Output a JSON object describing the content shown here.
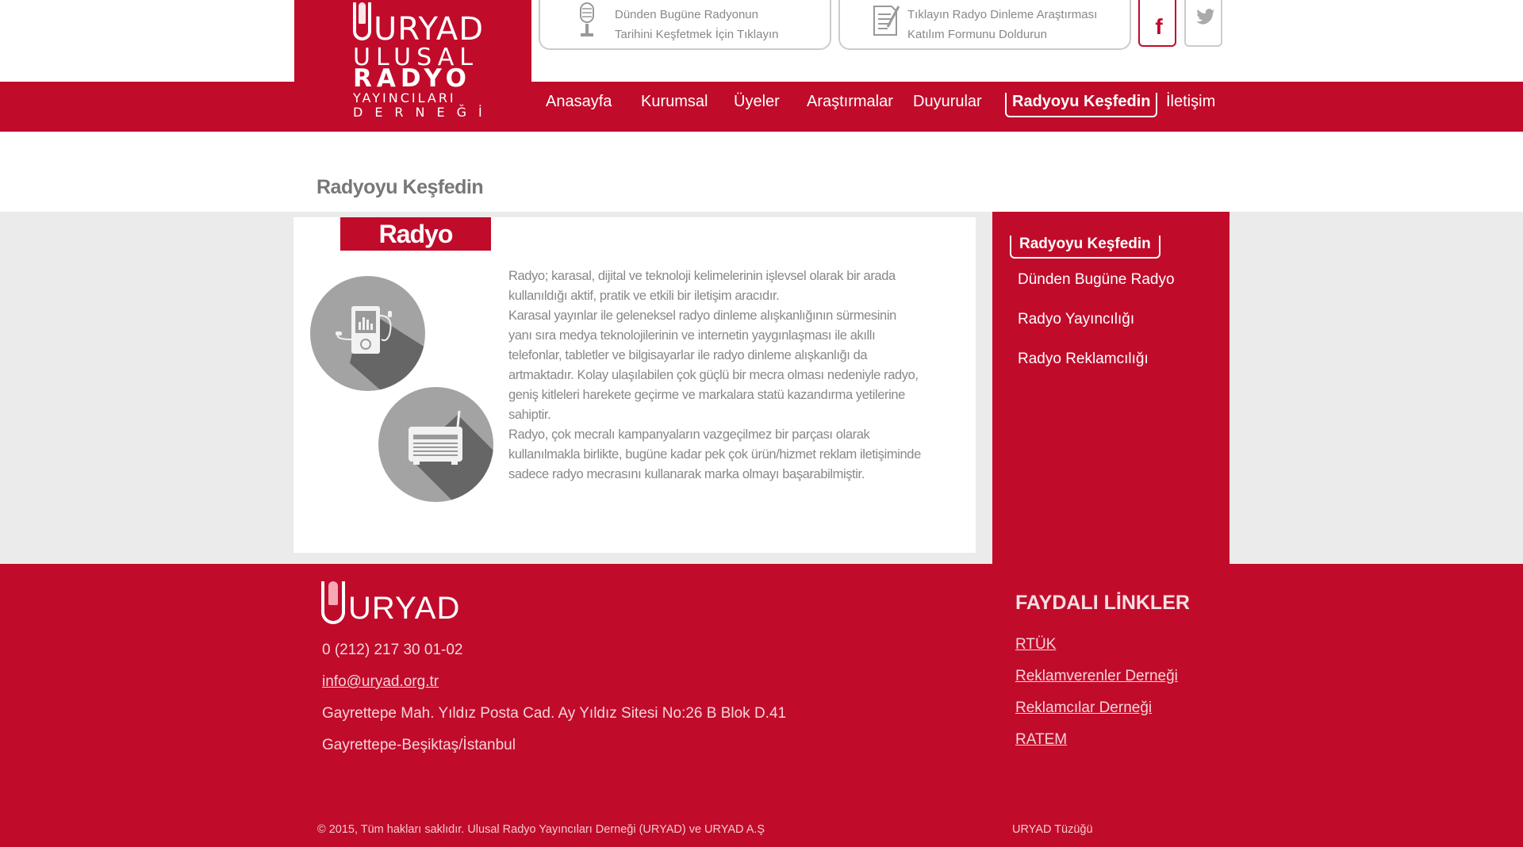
{
  "logo": {
    "brand": "URYAD",
    "line1": "ULUSAL",
    "line2": "RADYO",
    "line3": "YAYINCILARI",
    "line4": "DERNEĞİ"
  },
  "top_cards": [
    {
      "icon": "microphone-icon",
      "line1": "Dünden Bugüne Radyonun",
      "line2": "Tarihini Keşfetmek İçin Tıklayın"
    },
    {
      "icon": "document-icon",
      "line1": "Tıklayın Radyo Dinleme Araştırması",
      "line2": "Katılım Formunu Doldurun"
    }
  ],
  "social": [
    {
      "icon": "facebook-icon",
      "label": "f"
    },
    {
      "icon": "twitter-icon"
    }
  ],
  "nav": {
    "items": [
      "Anasayfa",
      "Kurumsal",
      "Üyeler",
      "Araştırmalar",
      "Duyurular",
      "Radyoyu Keşfedin",
      "İletişim"
    ],
    "active": "Radyoyu Keşfedin"
  },
  "page_title": "Radyoyu Keşfedin",
  "article": {
    "tag": "Radyo",
    "icons": [
      "mp3-player-icon",
      "radio-icon"
    ],
    "paragraphs": [
      "Radyo; karasal, dijital ve teknoloji kelimelerinin işlevsel olarak bir arada kullanıldığı aktif, pratik ve etkili bir iletişim aracıdır.",
      "Karasal yayınlar ile geleneksel radyo dinleme alışkanlığının sürmesinin yanı sıra medya teknolojilerinin ve internetin yaygınlaşması ile akıllı telefonlar, tabletler ve bilgisayarlar ile radyo dinleme alışkanlığı da artmaktadır. Kolay ulaşılabilen çok güçlü bir mecra olması nedeniyle radyo, geniş kitleleri harekete geçirme ve markalara statü kazandırma yetilerine sahiptir.",
      "Radyo, çok mecralı kampanyaların vazgeçilmez bir parçası olarak kullanılmakla birlikte, bugüne kadar pek çok ürün/hizmet reklam iletişiminde sadece radyo mecrasını kullanarak marka olmayı başarabilmiştir."
    ]
  },
  "sidebar": {
    "heading": "Radyoyu Keşfedin",
    "items": [
      "Dünden Bugüne Radyo",
      "Radyo Yayıncılığı",
      "Radyo Reklamcılığı"
    ]
  },
  "footer": {
    "brand": "URYAD",
    "phone": "0 (212) 217 30 01-02",
    "email": "info@uryad.org.tr",
    "address1": "Gayrettepe Mah. Yıldız Posta Cad. Ay Yıldız Sitesi No:26 B Blok D.41",
    "address2": "Gayrettepe-Beşiktaş/İstanbul",
    "links_title": "FAYDALI LİNKLER",
    "links": [
      "RTÜK",
      "Reklamverenler Derneği",
      "Reklamcılar Derneği",
      "RATEM"
    ],
    "copyright": "© 2015, Tüm hakları saklıdır. Ulusal Radyo Yayıncıları Derneği (URYAD) ve URYAD A.Ş",
    "bylaws": "URYAD Tüzüğü"
  },
  "colors": {
    "brand_red": "#c10b2a",
    "band_gray": "#ebebeb",
    "text_gray": "#888888"
  }
}
